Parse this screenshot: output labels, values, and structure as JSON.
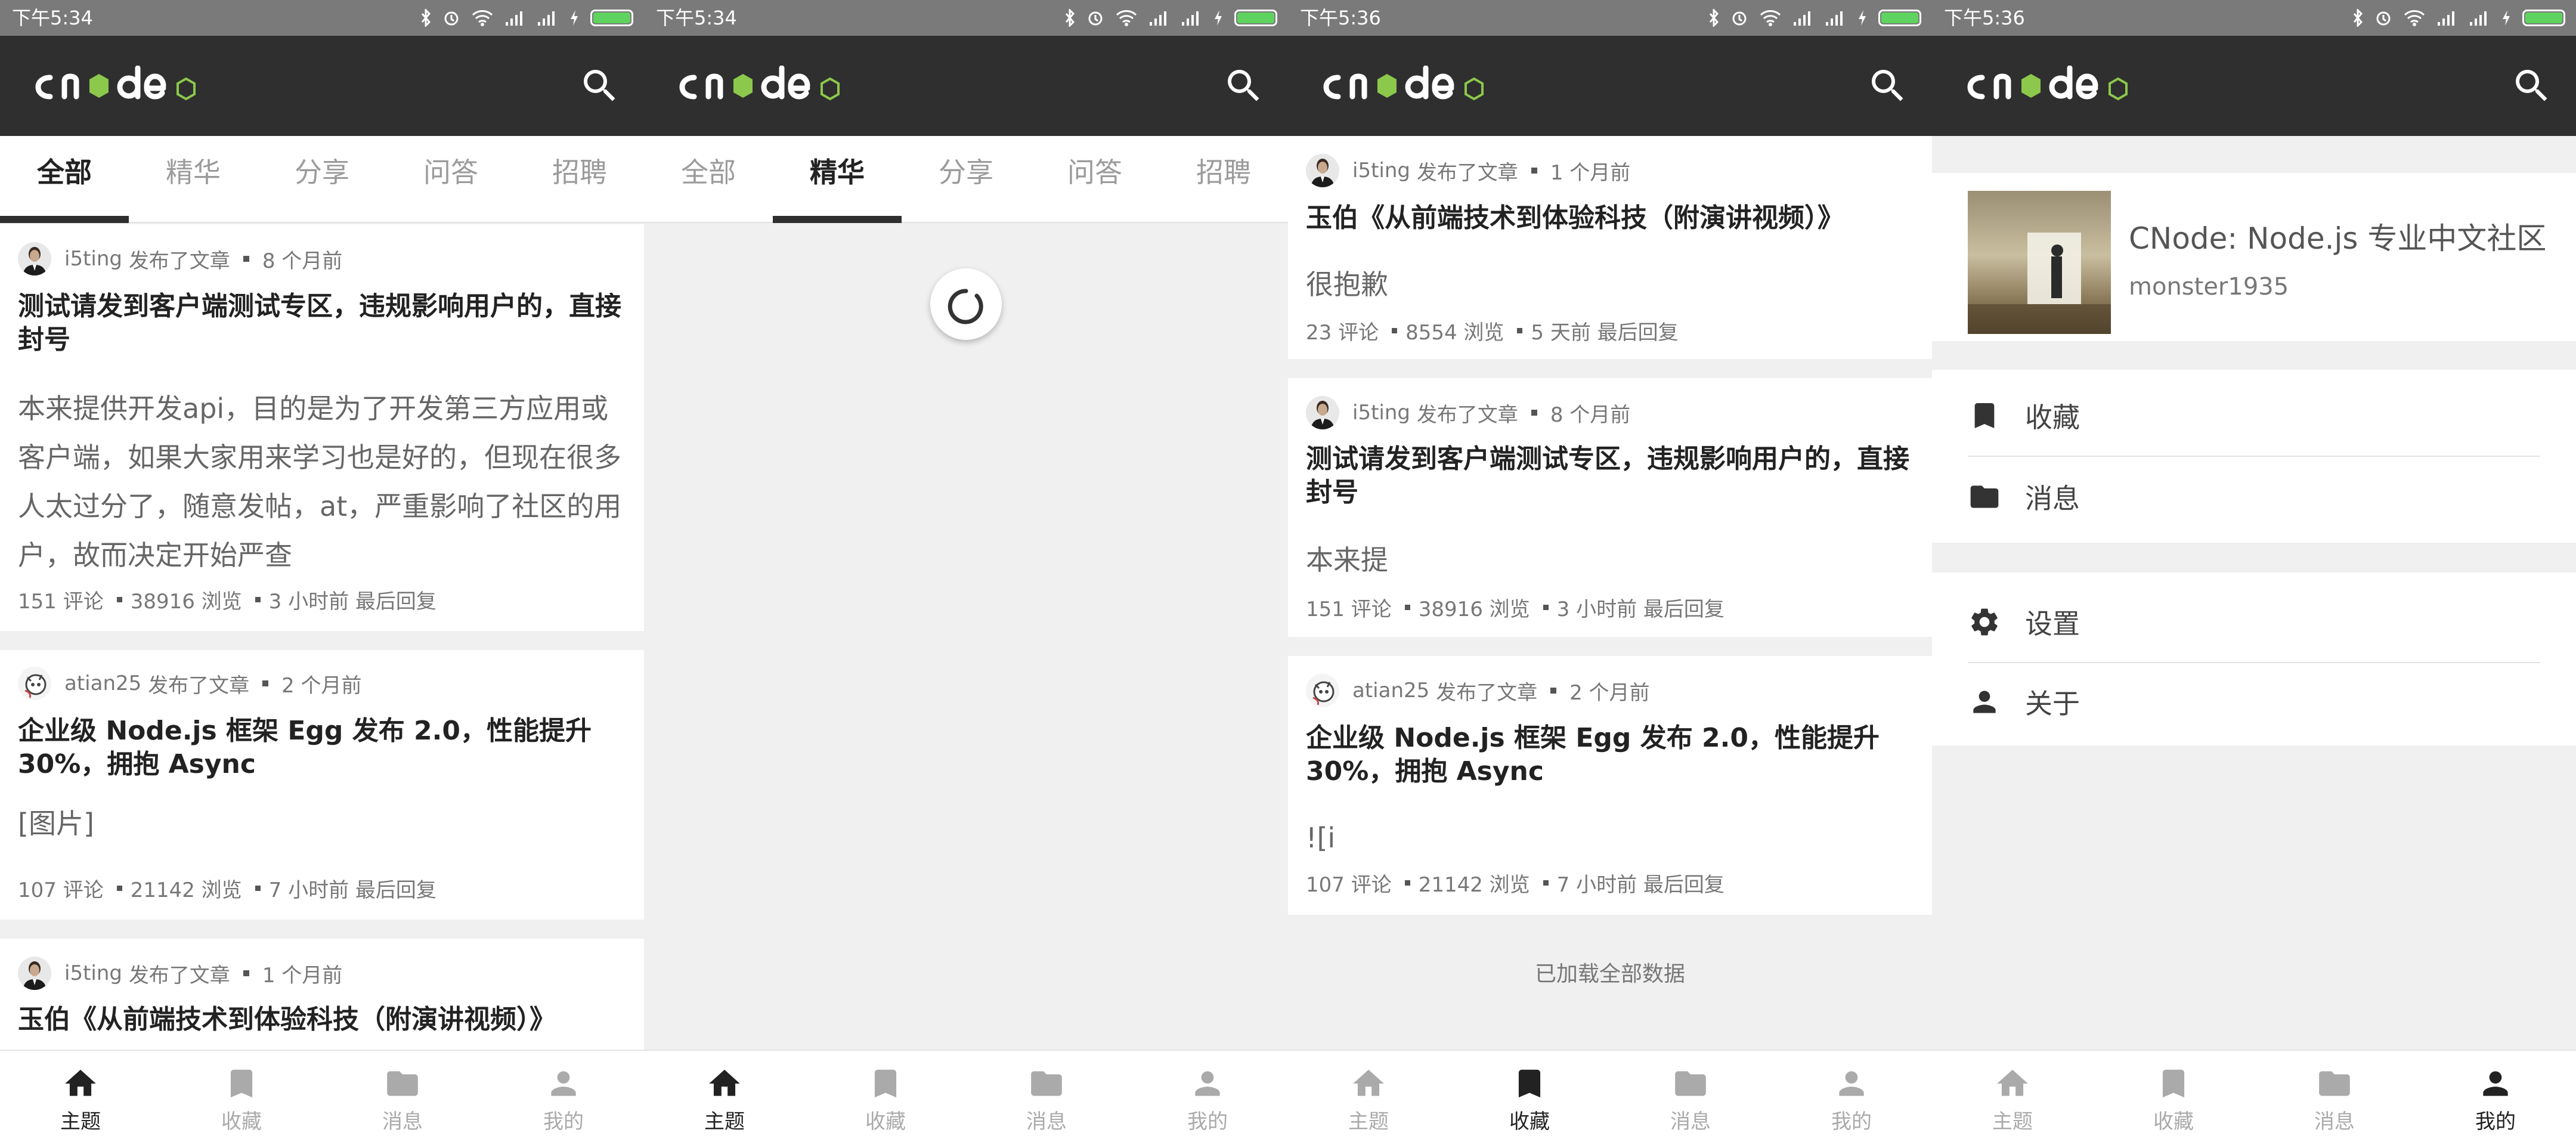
{
  "status": {
    "times": [
      "下午5:34",
      "下午5:34",
      "下午5:36",
      "下午5:36"
    ]
  },
  "app": {
    "logo_text": "cnode",
    "logo_badge": "JS"
  },
  "tabs": [
    "全部",
    "精华",
    "分享",
    "问答",
    "招聘"
  ],
  "bottom_nav": [
    "主题",
    "收藏",
    "消息",
    "我的"
  ],
  "screen1": {
    "topics": [
      {
        "author": "i5ting",
        "action": "发布了文章",
        "time": "8 个月前",
        "title": "测试请发到客户端测试专区，违规影响用户的，直接封号",
        "body": "本来提供开发api，目的是为了开发第三方应用或客户端，如果大家用来学习也是好的，但现在很多人太过分了，随意发帖，at，严重影响了社区的用户，故而决定开始严查",
        "comments": "151 评论",
        "views": "38916 浏览",
        "last_reply": "3 小时前 最后回复"
      },
      {
        "author": "atian25",
        "action": "发布了文章",
        "time": "2 个月前",
        "title": "企业级 Node.js 框架 Egg 发布 2.0，性能提升 30%，拥抱 Async",
        "body": "[图片]",
        "comments": "107 评论",
        "views": "21142 浏览",
        "last_reply": "7 小时前 最后回复"
      },
      {
        "author": "i5ting",
        "action": "发布了文章",
        "time": "1 个月前",
        "title": "玉伯《从前端技术到体验科技（附演讲视频）》"
      }
    ]
  },
  "screen3": {
    "topics": [
      {
        "author": "i5ting",
        "action": "发布了文章",
        "time": "1 个月前",
        "title": "玉伯《从前端技术到体验科技（附演讲视频）》",
        "body": "很抱歉",
        "comments": "23 评论",
        "views": "8554 浏览",
        "last_reply": "5 天前 最后回复"
      },
      {
        "author": "i5ting",
        "action": "发布了文章",
        "time": "8 个月前",
        "title": "测试请发到客户端测试专区，违规影响用户的，直接封号",
        "body": "本来提",
        "comments": "151 评论",
        "views": "38916 浏览",
        "last_reply": "3 小时前 最后回复"
      },
      {
        "author": "atian25",
        "action": "发布了文章",
        "time": "2 个月前",
        "title": "企业级 Node.js 框架 Egg 发布 2.0，性能提升 30%，拥抱 Async",
        "body": "![i",
        "comments": "107 评论",
        "views": "21142 浏览",
        "last_reply": "7 小时前 最后回复"
      }
    ],
    "loaded_all": "已加载全部数据"
  },
  "screen4": {
    "site_title": "CNode: Node.js 专业中文社区",
    "username": "monster1935",
    "menu1": [
      "收藏",
      "消息"
    ],
    "menu2": [
      "设置",
      "关于"
    ]
  },
  "active_tab": {
    "screen1": "全部",
    "screen2": "精华"
  },
  "active_nav": {
    "screen1": "主题",
    "screen2": "主题",
    "screen3": "收藏",
    "screen4": "我的"
  },
  "colors": {
    "appbar": "#2f2f2f",
    "status": "#7a7a7a",
    "accent": "#8cc84b",
    "battery": "#5fd35f"
  }
}
